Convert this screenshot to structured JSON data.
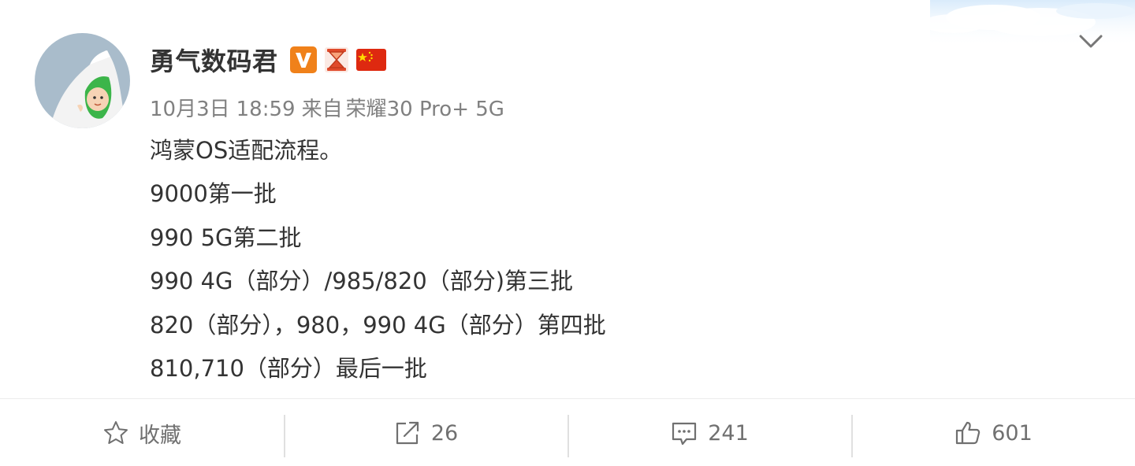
{
  "post": {
    "author": "勇气数码君",
    "badges": [
      "verified-v-badge",
      "hourglass-badge",
      "china-flag-badge"
    ],
    "meta": {
      "date": "10月3日",
      "time": "18:59",
      "source_prefix": "来自",
      "device": "荣耀30 Pro+ 5G"
    },
    "content_lines": [
      "鸿蒙OS适配流程。",
      "9000第一批",
      "990 5G第二批",
      "990 4G（部分）/985/820（部分)第三批",
      "820（部分），980，990 4G（部分）第四批",
      "810,710（部分）最后一批"
    ]
  },
  "actions": {
    "favorite_label": "收藏",
    "repost_count": "26",
    "comment_count": "241",
    "like_count": "601"
  },
  "colors": {
    "text_primary": "#333333",
    "text_meta": "#808080",
    "action_text": "#707070",
    "verified_orange": "#f0811a",
    "flag_red": "#de2910",
    "flag_yellow": "#ffde00"
  }
}
